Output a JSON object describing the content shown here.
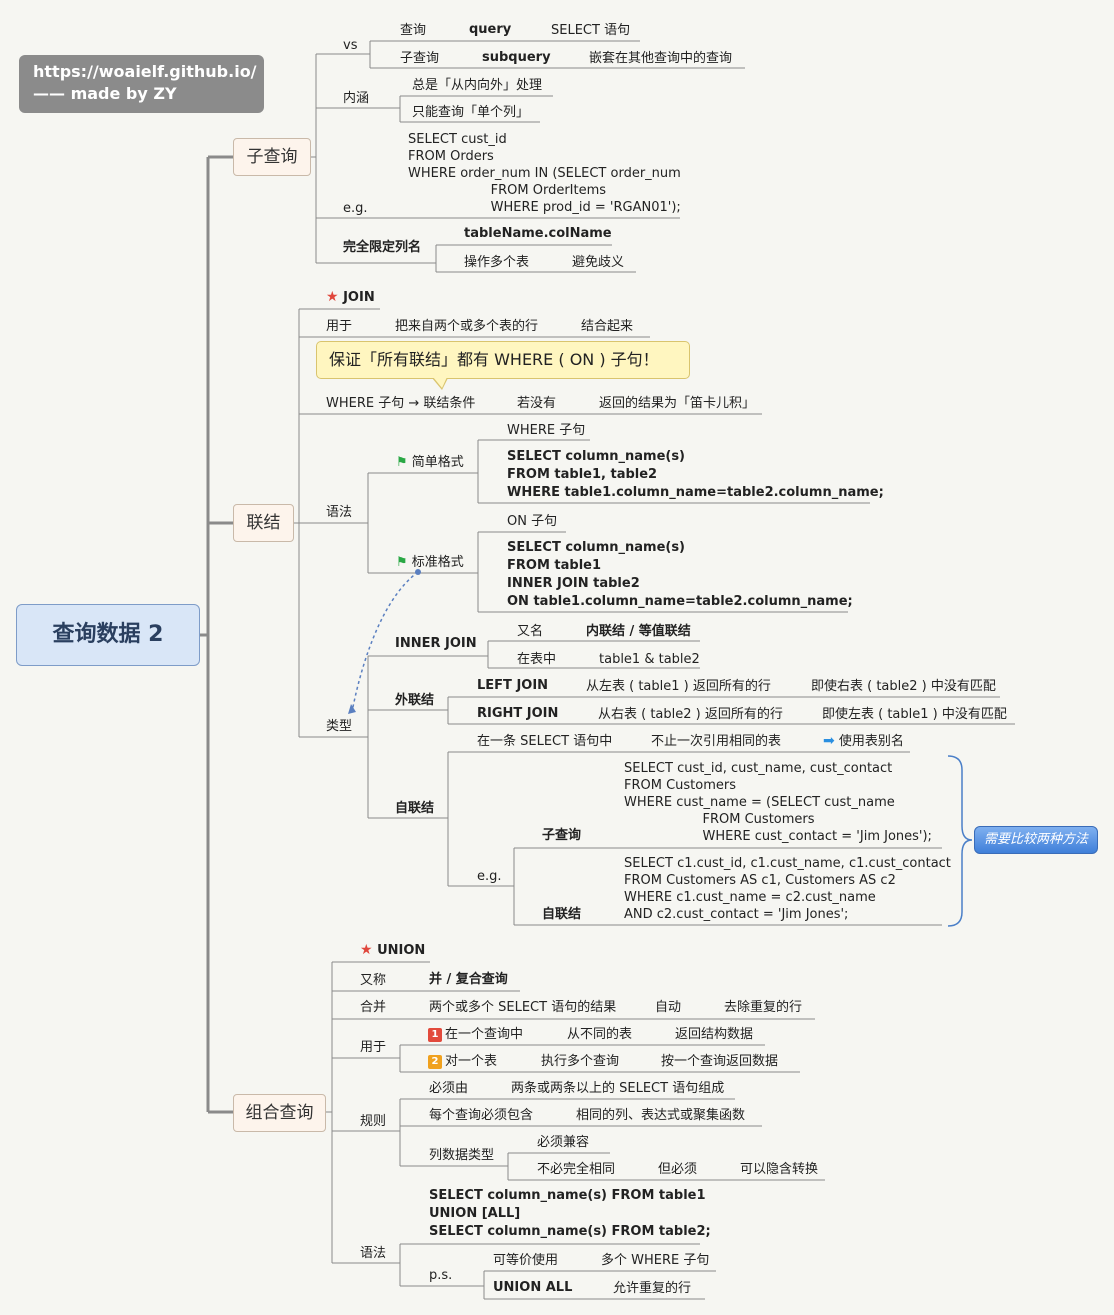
{
  "watermark": {
    "line1": "https://woaielf.github.io/",
    "line2": "—— made by ZY"
  },
  "root": "查询数据 2",
  "subquery": {
    "title": "子查询",
    "vs": "vs",
    "vs_rows": [
      [
        "查询",
        "query",
        "SELECT 语句"
      ],
      [
        "子查询",
        "subquery",
        "嵌套在其他查询中的查询"
      ]
    ],
    "meaning": "内涵",
    "meaning_rows": [
      "总是「从内向外」处理",
      "只能查询「单个列」"
    ],
    "eg": "e.g.",
    "eg_code": [
      "SELECT cust_id",
      "FROM Orders",
      "WHERE order_num IN (SELECT order_num",
      "                    FROM OrderItems",
      "                    WHERE prod_id = 'RGAN01');"
    ],
    "qualified": "完全限定列名",
    "qualified_syntax": "tableName.colName",
    "qualified_use": "操作多个表",
    "qualified_purpose": "避免歧义"
  },
  "join": {
    "title": "联结",
    "join_label": "JOIN",
    "use_label": "用于",
    "use_text": "把来自两个或多个表的行",
    "use_result": "结合起来",
    "callout": "保证「所有联结」都有 WHERE ( ON ) 子句！",
    "where_label": "WHERE 子句 → 联结条件",
    "if_none": "若没有",
    "cartesian": "返回的结果为「笛卡儿积」",
    "syntax": "语法",
    "simple": "简单格式",
    "simple_clause": "WHERE 子句",
    "simple_code": [
      "SELECT column_name(s)",
      "FROM table1, table2",
      "WHERE table1.column_name=table2.column_name;"
    ],
    "standard": "标准格式",
    "standard_clause": "ON 子句",
    "standard_code": [
      "SELECT column_name(s)",
      "FROM table1",
      "INNER JOIN table2",
      "ON table1.column_name=table2.column_name;"
    ],
    "types": "类型",
    "inner": "INNER JOIN",
    "aka": "又名",
    "inner_alias": "内联结 / 等值联结",
    "in_table": "在表中",
    "inner_tables": "table1 & table2",
    "outer": "外联结",
    "left": "LEFT JOIN",
    "left_desc": "从左表 ( table1 ) 返回所有的行",
    "left_note": "即使右表 ( table2 ) 中没有匹配",
    "right": "RIGHT JOIN",
    "right_desc": "从右表 ( table2 ) 返回所有的行",
    "right_note": "即使左表 ( table1 ) 中没有匹配",
    "self": "自联结",
    "self_in": "在一条 SELECT 语句中",
    "self_multi": "不止一次引用相同的表",
    "self_alias": "使用表别名",
    "self_eg": "e.g.",
    "sub_label": "子查询",
    "sub_code": [
      "SELECT cust_id, cust_name, cust_contact",
      "FROM Customers",
      "WHERE cust_name = (SELECT cust_name",
      "                   FROM Customers",
      "                   WHERE cust_contact = 'Jim Jones');"
    ],
    "self_label": "自联结",
    "self_code": [
      "SELECT c1.cust_id, c1.cust_name, c1.cust_contact",
      "FROM Customers AS c1, Customers AS c2",
      "WHERE c1.cust_name = c2.cust_name",
      "AND c2.cust_contact = 'Jim Jones';"
    ],
    "compare_note": "需要比较两种方法"
  },
  "union": {
    "title": "组合查询",
    "union_label": "UNION",
    "aka": "又称",
    "aka_value": "并 / 复合查询",
    "merge": "合并",
    "merge_text": "两个或多个 SELECT 语句的结果",
    "auto": "自动",
    "dedupe": "去除重复的行",
    "use": "用于",
    "use1_num": "1",
    "use1": "在一个查询中",
    "use1_from": "从不同的表",
    "use1_ret": "返回结构数据",
    "use2_num": "2",
    "use2": "对一个表",
    "use2_exec": "执行多个查询",
    "use2_ret": "按一个查询返回数据",
    "rules": "规则",
    "must_by": "必须由",
    "must_by_text": "两条或两条以上的 SELECT 语句组成",
    "each_must": "每个查询必须包含",
    "each_must_text": "相同的列、表达式或聚集函数",
    "col_type": "列数据类型",
    "compat": "必须兼容",
    "not_same": "不必完全相同",
    "but": "但必须",
    "implicit": "可以隐含转换",
    "syntax": "语法",
    "syntax_code": [
      "SELECT column_name(s) FROM table1",
      "UNION [ALL]",
      "SELECT column_name(s) FROM table2;"
    ],
    "ps": "p.s.",
    "equiv": "可等价使用",
    "multi_where": "多个 WHERE 子句",
    "union_all": "UNION ALL",
    "allow_dup": "允许重复的行"
  },
  "colors": {
    "root_fill": "#d9e6f7",
    "topic_fill": "#fdf4ec",
    "callout_fill": "#fff6c0",
    "note_fill": "#3f7fd9",
    "line": "#8a8a8a"
  }
}
